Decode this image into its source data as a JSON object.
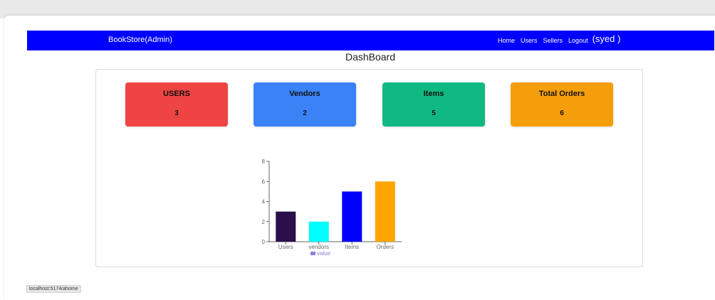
{
  "navbar": {
    "brand": "BookStore(Admin)",
    "links": [
      "Home",
      "Users",
      "Sellers",
      "Logout"
    ],
    "user": "(syed )",
    "color": "#0000ff"
  },
  "page_title": "DashBoard",
  "cards": [
    {
      "label": "USERS",
      "value": "3",
      "color": "#ef4444"
    },
    {
      "label": "Vendors",
      "value": "2",
      "color": "#3b82f6"
    },
    {
      "label": "Items",
      "value": "5",
      "color": "#10b981"
    },
    {
      "label": "Total Orders",
      "value": "6",
      "color": "#f59e0b"
    }
  ],
  "chart_data": {
    "type": "bar",
    "categories": [
      "Users",
      "vendors",
      "Items",
      "Orders"
    ],
    "values": [
      3,
      2,
      5,
      6
    ],
    "colors": [
      "#2a0f4a",
      "#00ffff",
      "#0000ff",
      "#ffa500"
    ],
    "yticks": [
      0,
      2,
      4,
      6,
      8
    ],
    "ylim": [
      0,
      8
    ],
    "legend": "value",
    "legend_color": "#8884d8",
    "legend_position": "bottom"
  },
  "status_bar": "localhost:5174/ahome"
}
